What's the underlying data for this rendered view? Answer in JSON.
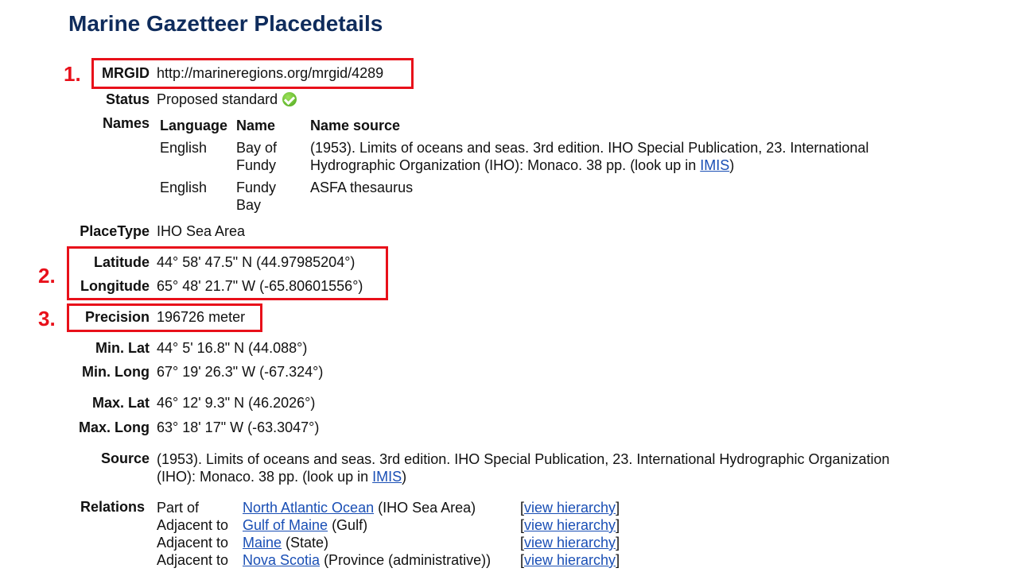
{
  "page": {
    "title": "Marine Gazetteer Placedetails"
  },
  "annotations": [
    "1.",
    "2.",
    "3."
  ],
  "fields": {
    "mrgid": {
      "label": "MRGID",
      "value": "http://marineregions.org/mrgid/4289"
    },
    "status": {
      "label": "Status",
      "value": "Proposed standard",
      "icon": "check-circle-icon"
    },
    "names": {
      "label": "Names",
      "headers": [
        "Language",
        "Name",
        "Name source"
      ],
      "rows": [
        {
          "language": "English",
          "name_line1": "Bay of",
          "name_line2": "Fundy",
          "source_line1": "(1953). Limits of oceans and seas. 3rd edition. IHO Special Publication, 23. International",
          "source_line2": "Hydrographic Organization (IHO): Monaco. 38 pp. (look up in ",
          "source_link": "IMIS",
          "source_end": ")"
        },
        {
          "language": "English",
          "name_line1": "Fundy",
          "name_line2": "Bay",
          "source_line1": "ASFA thesaurus"
        }
      ]
    },
    "placetype": {
      "label": "PlaceType",
      "value": "IHO Sea Area"
    },
    "latitude": {
      "label": "Latitude",
      "value": "44° 58' 47.5\" N (44.97985204°)"
    },
    "longitude": {
      "label": "Longitude",
      "value": "65° 48' 21.7\" W (-65.80601556°)"
    },
    "precision": {
      "label": "Precision",
      "value": "196726 meter"
    },
    "min_lat": {
      "label": "Min. Lat",
      "value": "44° 5' 16.8\" N (44.088°)"
    },
    "min_long": {
      "label": "Min. Long",
      "value": "67° 19' 26.3\" W (-67.324°)"
    },
    "max_lat": {
      "label": "Max. Lat",
      "value": "46° 12' 9.3\" N (46.2026°)"
    },
    "max_long": {
      "label": "Max. Long",
      "value": "63° 18' 17\" W (-63.3047°)"
    },
    "source": {
      "label": "Source",
      "line1": "(1953). Limits of oceans and seas. 3rd edition. IHO Special Publication, 23. International Hydrographic Organization",
      "line2": "(IHO): Monaco. 38 pp. (look up in ",
      "link": "IMIS",
      "end": ")"
    },
    "relations": {
      "label": "Relations",
      "rows": [
        {
          "type": "Part of",
          "link": "North Atlantic Ocean",
          "kind": " (IHO Sea Area)",
          "hier_open": "[",
          "hier_link": "view hierarchy",
          "hier_close": "]"
        },
        {
          "type": "Adjacent to",
          "link": "Gulf of Maine",
          "kind": " (Gulf)",
          "hier_open": "[",
          "hier_link": "view hierarchy",
          "hier_close": "]"
        },
        {
          "type": "Adjacent to",
          "link": "Maine",
          "kind": " (State)",
          "hier_open": "[",
          "hier_link": "view hierarchy",
          "hier_close": "]"
        },
        {
          "type": "Adjacent to",
          "link": "Nova Scotia",
          "kind": " (Province (administrative))",
          "hier_open": "[",
          "hier_link": "view hierarchy",
          "hier_close": "]"
        }
      ]
    }
  }
}
